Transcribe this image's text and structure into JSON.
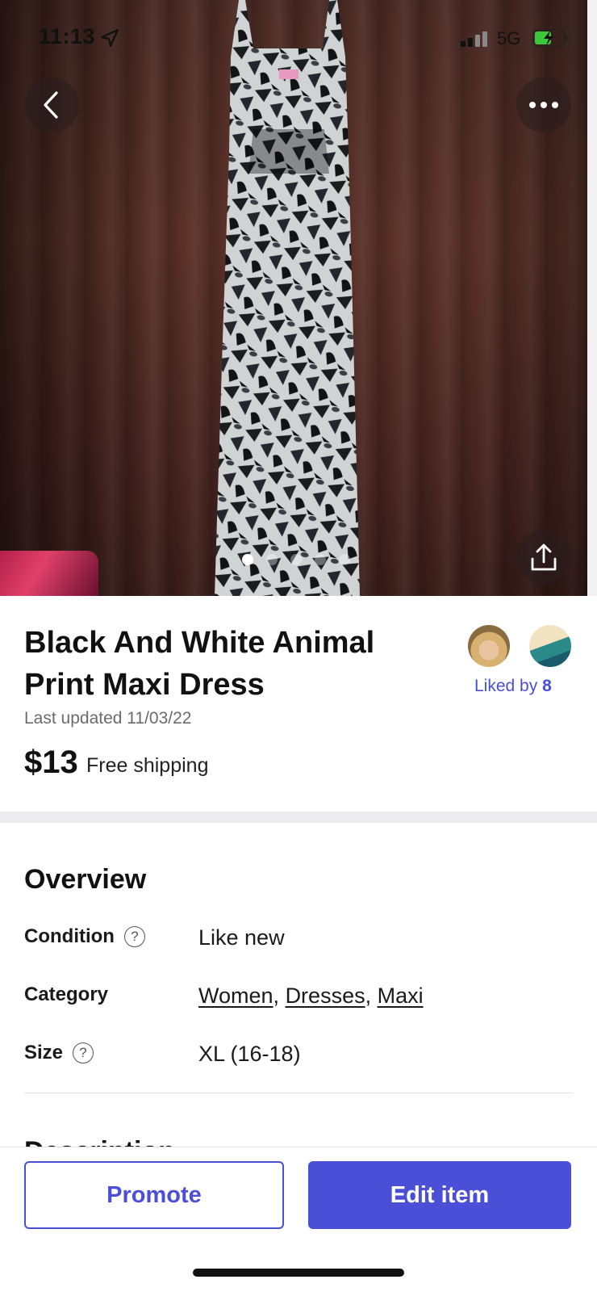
{
  "status_bar": {
    "time": "11:13",
    "network": "5G",
    "icons": [
      "location-arrow-icon",
      "signal-icon",
      "battery-charging-icon"
    ]
  },
  "photo": {
    "carousel_count": 5,
    "active_index": 0,
    "icons": [
      "chevron-left-icon",
      "more-horizontal-icon",
      "share-icon"
    ]
  },
  "item": {
    "title": "Black And White Animal Print Maxi Dress",
    "last_updated": "Last updated 11/03/22",
    "price": "$13",
    "shipping": "Free shipping",
    "liked_by_prefix": "Liked by ",
    "liked_by_count": "8"
  },
  "overview": {
    "heading": "Overview",
    "condition_label": "Condition",
    "condition_value": "Like new",
    "category_label": "Category",
    "category_links": [
      "Women",
      "Dresses",
      "Maxi"
    ],
    "category_separator": ", ",
    "size_label": "Size",
    "size_value": "XL (16-18)",
    "help_glyph": "?"
  },
  "description": {
    "heading": "Description"
  },
  "actions": {
    "promote_label": "Promote",
    "edit_label": "Edit item"
  },
  "colors": {
    "accent": "#4b4fd8",
    "text": "#1a1a1a",
    "muted": "#6b6b6b"
  }
}
